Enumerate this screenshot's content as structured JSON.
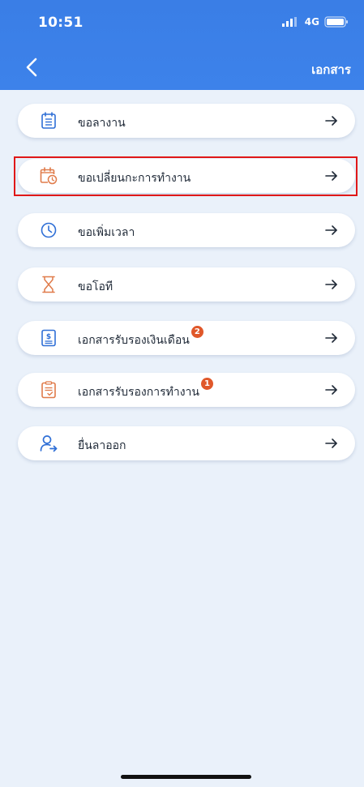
{
  "status_bar": {
    "time": "10:51",
    "network": "4G"
  },
  "nav": {
    "title": "เอกสาร"
  },
  "menu": {
    "items": [
      {
        "label": "ขอลางาน",
        "icon": "calendar-list-icon",
        "badge": ""
      },
      {
        "label": "ขอเปลี่ยนกะการทำงาน",
        "icon": "calendar-clock-icon",
        "badge": ""
      },
      {
        "label": "ขอเพิ่มเวลา",
        "icon": "clock-icon",
        "badge": ""
      },
      {
        "label": "ขอโอที",
        "icon": "hourglass-icon",
        "badge": ""
      },
      {
        "label": "เอกสารรับรองเงินเดือน",
        "icon": "salary-document-icon",
        "badge": "2"
      },
      {
        "label": "เอกสารรับรองการทำงาน",
        "icon": "checklist-document-icon",
        "badge": "1"
      },
      {
        "label": "ยื่นลาออก",
        "icon": "user-exit-icon",
        "badge": ""
      }
    ]
  },
  "colors": {
    "header": "#3d82ea",
    "background": "#eaf1fa",
    "blue_icon": "#2f6fd6",
    "orange_icon": "#e07b4a",
    "badge": "#e0582a",
    "highlight": "#e01818"
  }
}
